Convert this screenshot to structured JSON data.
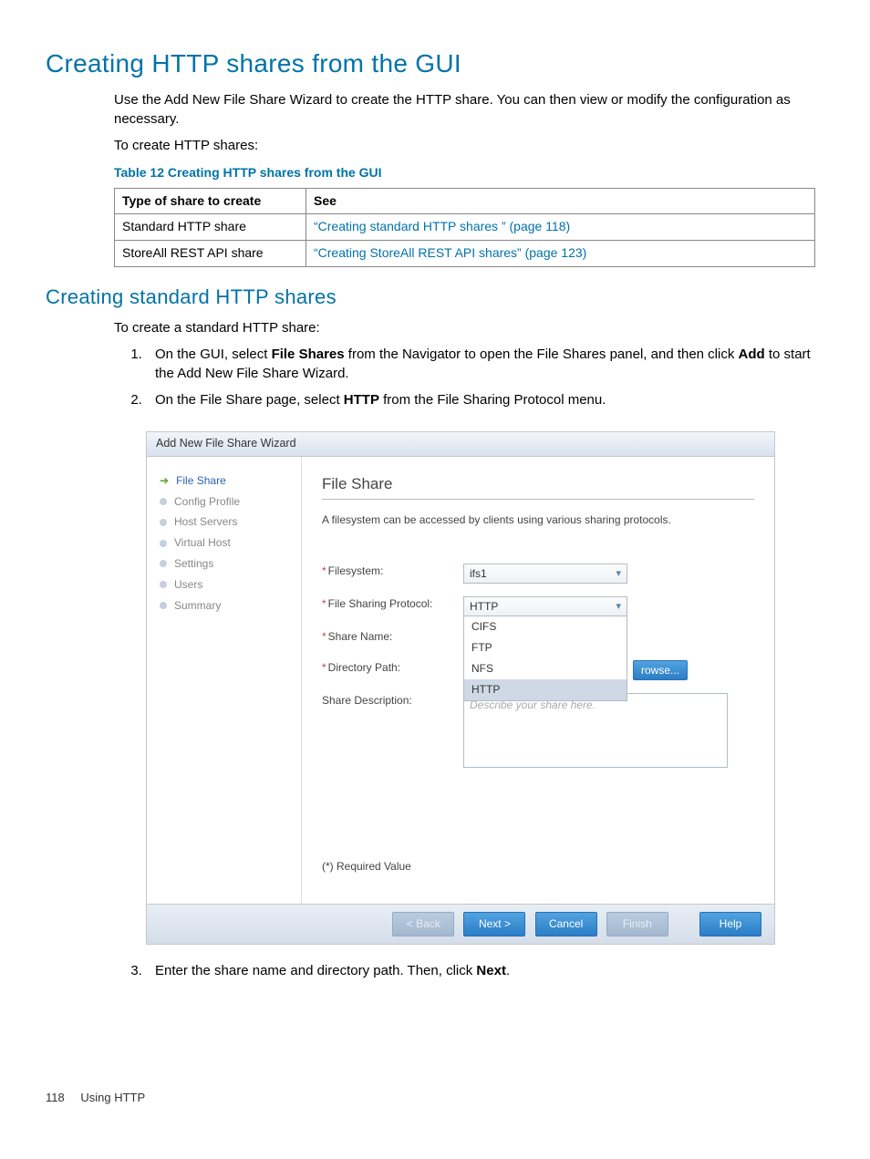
{
  "page": {
    "h1": "Creating HTTP shares from the GUI",
    "intro": "Use the Add New File Share Wizard to create the HTTP share. You can then view or modify the configuration as necessary.",
    "prelist": "To create HTTP shares:",
    "table_caption": "Table 12 Creating HTTP shares from the GUI",
    "table": {
      "headers": [
        "Type of share to create",
        "See"
      ],
      "rows": [
        [
          "Standard HTTP share",
          "“Creating standard HTTP shares ” (page 118)"
        ],
        [
          "StoreAll REST API share",
          "“Creating StoreAll REST API shares” (page 123)"
        ]
      ]
    },
    "h2": "Creating standard HTTP shares",
    "sub_intro": "To create a standard HTTP share:",
    "steps": {
      "s1_a": "On the GUI, select ",
      "s1_b": "File Shares",
      "s1_c": " from the Navigator to open the File Shares panel, and then click ",
      "s1_d": "Add",
      "s1_e": " to start the Add New File Share Wizard.",
      "s2_a": "On the File Share page, select ",
      "s2_b": "HTTP",
      "s2_c": " from the File Sharing Protocol menu.",
      "s3_a": "Enter the share name and directory path. Then, click ",
      "s3_b": "Next",
      "s3_c": "."
    },
    "footer_page": "118",
    "footer_section": "Using HTTP"
  },
  "wizard": {
    "title": "Add New File Share Wizard",
    "nav": [
      "File Share",
      "Config Profile",
      "Host Servers",
      "Virtual Host",
      "Settings",
      "Users",
      "Summary"
    ],
    "heading": "File Share",
    "desc": "A filesystem can be accessed by clients using various sharing protocols.",
    "labels": {
      "filesystem": "Filesystem:",
      "protocol": "File Sharing Protocol:",
      "sharename": "Share Name:",
      "dirpath": "Directory Path:",
      "desc": "Share Description:"
    },
    "values": {
      "filesystem": "ifs1",
      "protocol": "HTTP",
      "browse": "rowse...",
      "placeholder": "Describe your share here."
    },
    "protocol_options": [
      "CIFS",
      "FTP",
      "NFS",
      "HTTP"
    ],
    "required_note": "(*) Required Value",
    "buttons": {
      "back": "< Back",
      "next": "Next >",
      "cancel": "Cancel",
      "finish": "Finish",
      "help": "Help"
    }
  }
}
